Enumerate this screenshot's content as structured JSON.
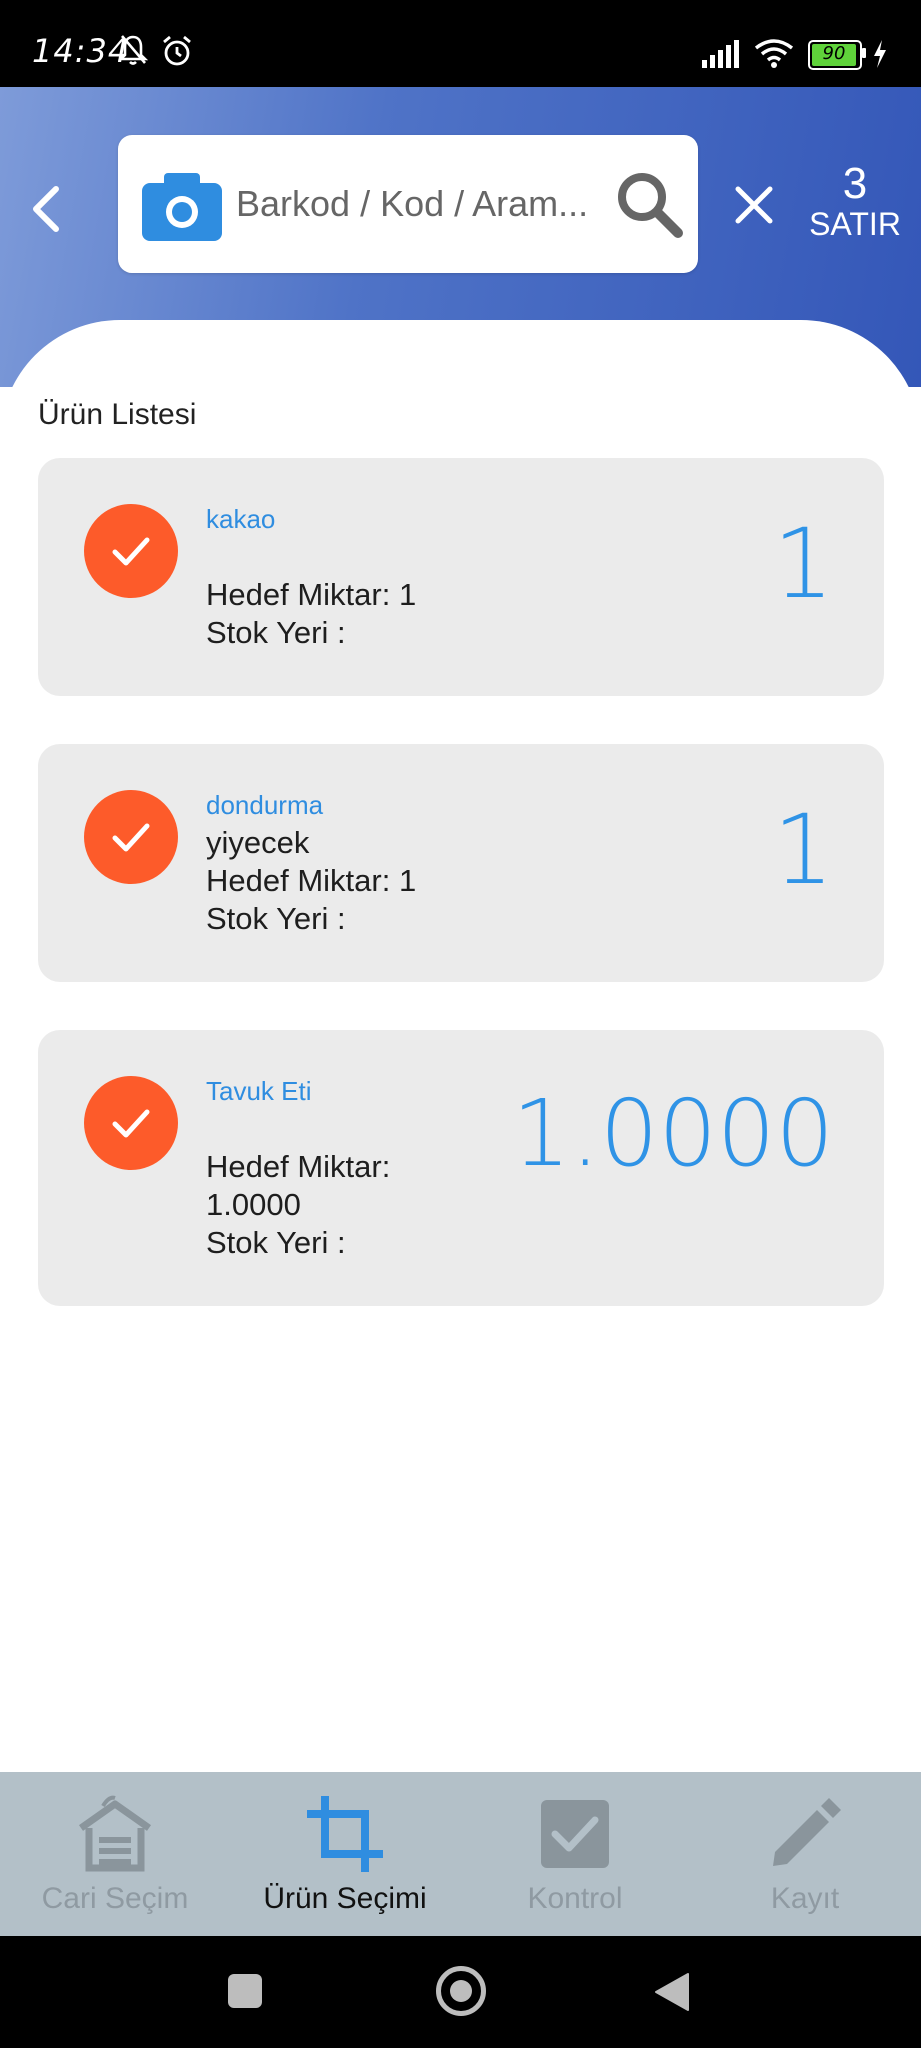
{
  "status_bar": {
    "time": "14:34",
    "battery": "90"
  },
  "header": {
    "search_placeholder": "Barkod / Kod / Aram...",
    "row_count": "3",
    "row_count_label": "SATIR"
  },
  "list": {
    "title": "Ürün Listesi",
    "items": [
      {
        "name": "kakao",
        "category": "",
        "target_line1": "Hedef Miktar: 1",
        "target_line2": "",
        "location": "Stok Yeri :",
        "quantity": "1"
      },
      {
        "name": "dondurma",
        "category": "yiyecek",
        "target_line1": "Hedef Miktar: 1",
        "target_line2": "",
        "location": "Stok Yeri :",
        "quantity": "1"
      },
      {
        "name": "Tavuk Eti",
        "category": "",
        "target_line1": "Hedef Miktar:",
        "target_line2": "1.0000",
        "location": "Stok Yeri :",
        "quantity": "1.0000"
      }
    ]
  },
  "bottom_nav": {
    "items": [
      {
        "label": "Cari Seçim",
        "icon": "warehouse-icon",
        "active": false
      },
      {
        "label": "Ürün Seçimi",
        "icon": "crop-icon",
        "active": true
      },
      {
        "label": "Kontrol",
        "icon": "checkbox-icon",
        "active": false
      },
      {
        "label": "Kayıt",
        "icon": "pencil-icon",
        "active": false
      }
    ]
  },
  "colors": {
    "accent_blue": "#2f93e6",
    "check_orange": "#fd5b2a",
    "card_bg": "#ebebeb",
    "nav_bg": "#b3c0c8"
  }
}
